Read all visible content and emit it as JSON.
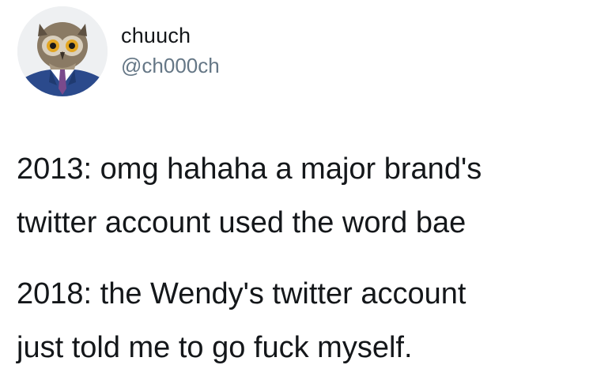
{
  "user": {
    "display_name": "chuuch",
    "handle": "@ch000ch",
    "avatar_icon": "owl-in-suit-avatar-icon"
  },
  "tweet": {
    "lines": [
      "2013: omg hahaha a major brand's",
      "twitter account used the word bae",
      "2018: the Wendy's twitter account",
      "just told me to go fuck myself."
    ]
  },
  "colors": {
    "text": "#14171a",
    "handle": "#657786",
    "suit": "#2b4a8c",
    "tie": "#7a4a8c"
  }
}
